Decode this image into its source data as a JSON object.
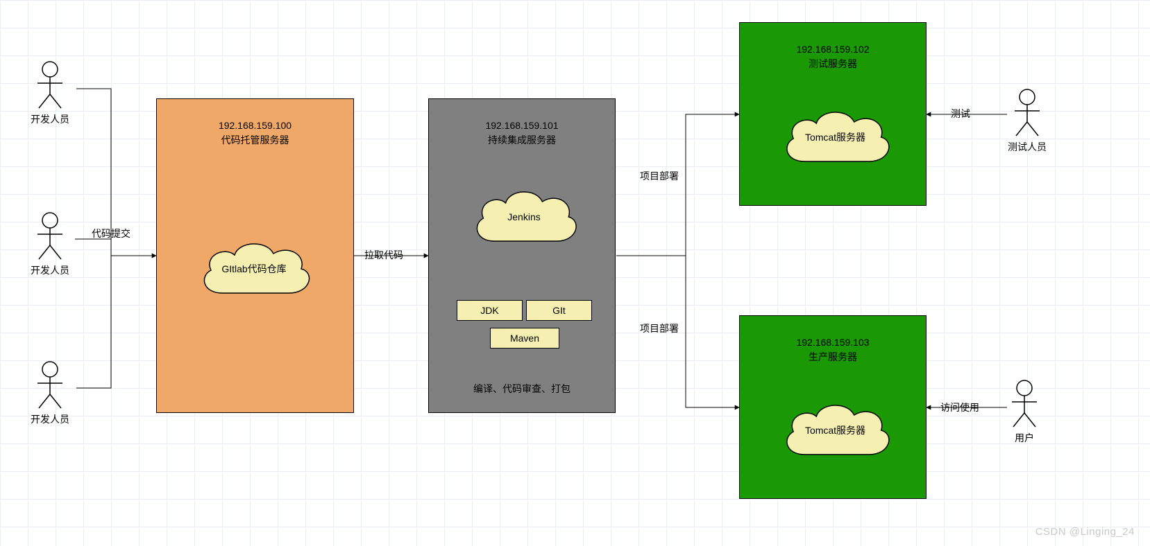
{
  "actors": {
    "dev1": "开发人员",
    "dev2": "开发人员",
    "dev3": "开发人员",
    "tester": "测试人员",
    "user": "用户"
  },
  "servers": {
    "gitlab": {
      "ip": "192.168.159.100",
      "name": "代码托管服务器",
      "cloud": "GItlab代码仓库"
    },
    "jenkins": {
      "ip": "192.168.159.101",
      "name": "持续集成服务器",
      "cloud": "Jenkins",
      "tools": {
        "jdk": "JDK",
        "git": "GIt",
        "maven": "Maven"
      },
      "footer": "编译、代码审查、打包"
    },
    "test": {
      "ip": "192.168.159.102",
      "name": "测试服务器",
      "cloud": "Tomcat服务器"
    },
    "prod": {
      "ip": "192.168.159.103",
      "name": "生产服务器",
      "cloud": "Tomcat服务器"
    }
  },
  "edges": {
    "commit": "代码提交",
    "pull": "拉取代码",
    "deploy1": "项目部署",
    "deploy2": "项目部署",
    "test": "测试",
    "access": "访问使用"
  },
  "watermark": "CSDN @Linging_24"
}
